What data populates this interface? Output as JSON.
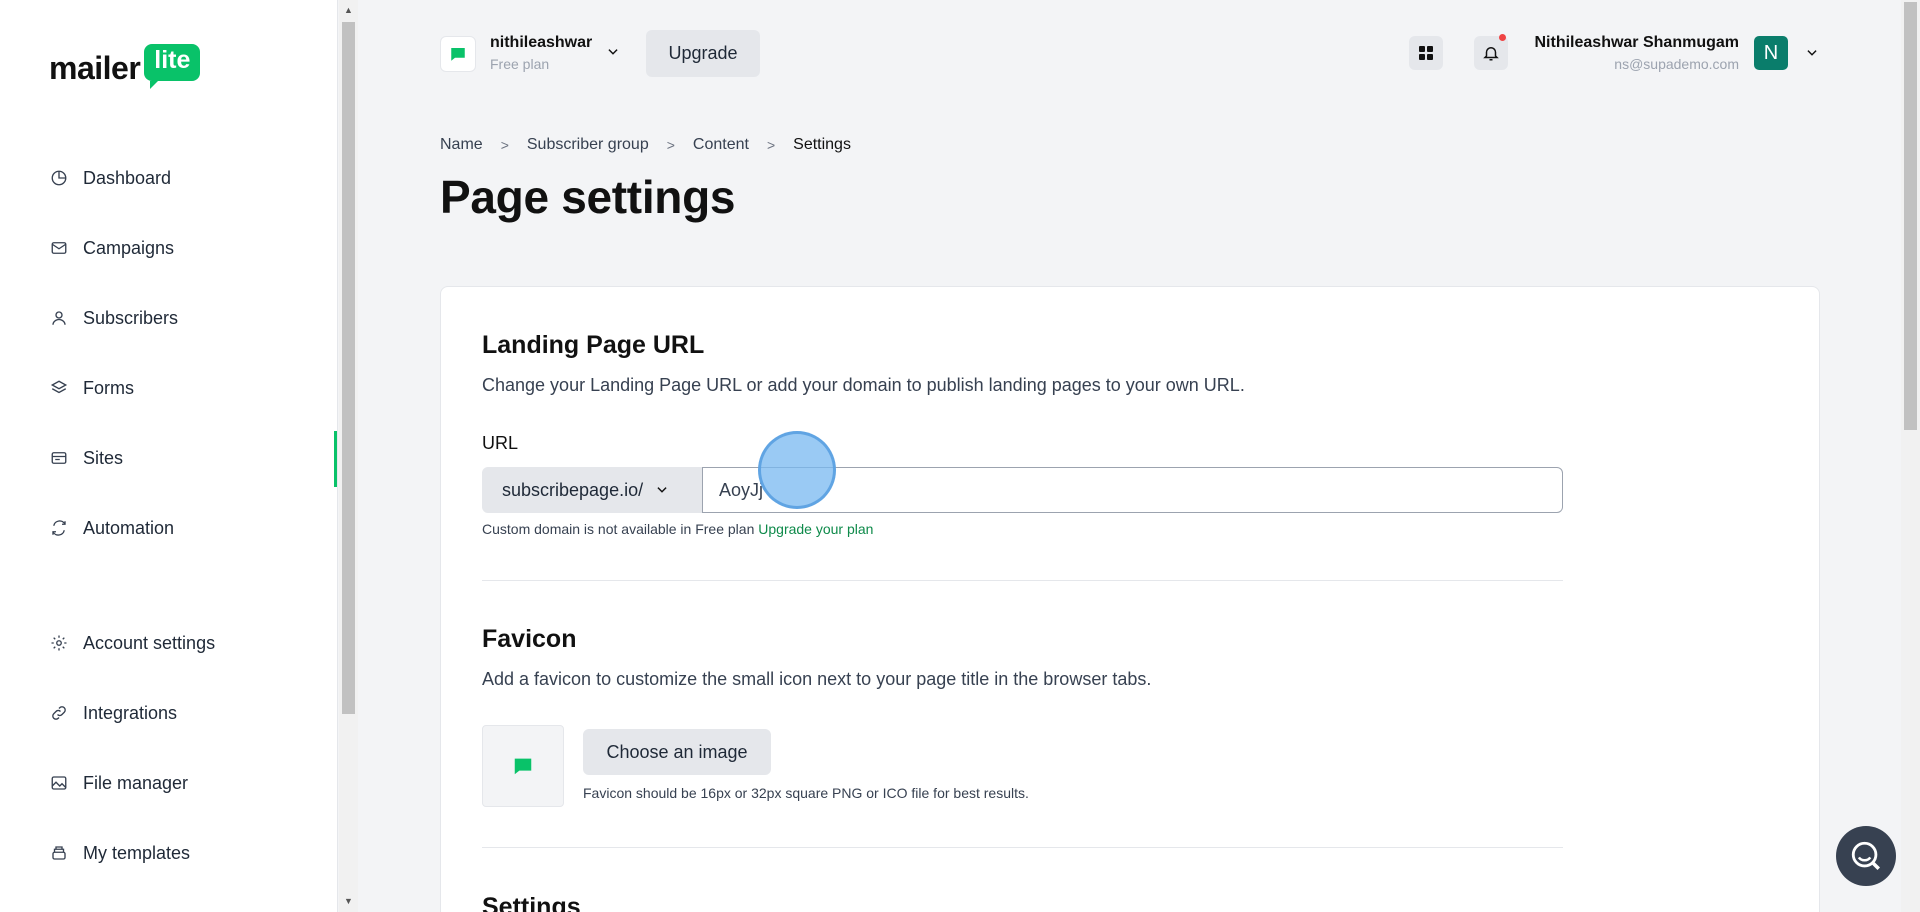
{
  "brand": {
    "logo_word": "mailer",
    "logo_badge": "lite",
    "accent": "#09c269"
  },
  "sidebar": {
    "items": [
      {
        "label": "Dashboard",
        "icon": "pie-chart-icon"
      },
      {
        "label": "Campaigns",
        "icon": "envelope-icon"
      },
      {
        "label": "Subscribers",
        "icon": "user-icon"
      },
      {
        "label": "Forms",
        "icon": "layers-icon"
      },
      {
        "label": "Sites",
        "icon": "browser-icon",
        "active": true
      },
      {
        "label": "Automation",
        "icon": "refresh-icon"
      },
      {
        "label": "Account settings",
        "icon": "gear-icon"
      },
      {
        "label": "Integrations",
        "icon": "link-icon"
      },
      {
        "label": "File manager",
        "icon": "image-icon"
      },
      {
        "label": "My templates",
        "icon": "stack-icon"
      }
    ]
  },
  "header": {
    "account_name": "nithileashwar",
    "account_plan": "Free plan",
    "upgrade_label": "Upgrade",
    "user_name": "Nithileashwar Shanmugam",
    "user_email": "ns@supademo.com",
    "avatar_initial": "N"
  },
  "breadcrumb": [
    "Name",
    "Subscriber group",
    "Content",
    "Settings"
  ],
  "page_title": "Page settings",
  "landing": {
    "title": "Landing Page URL",
    "description": "Change your Landing Page URL or add your domain to publish landing pages to your own URL.",
    "url_label": "URL",
    "domain": "subscribepage.io/",
    "url_value": "AoyJj",
    "help_text": "Custom domain is not available in Free plan",
    "help_link": "Upgrade your plan"
  },
  "favicon": {
    "title": "Favicon",
    "description": "Add a favicon to customize the small icon next to your page title in the browser tabs.",
    "choose_label": "Choose an image",
    "help_text": "Favicon should be 16px or 32px square PNG or ICO file for best results."
  },
  "settings": {
    "title": "Settings"
  }
}
